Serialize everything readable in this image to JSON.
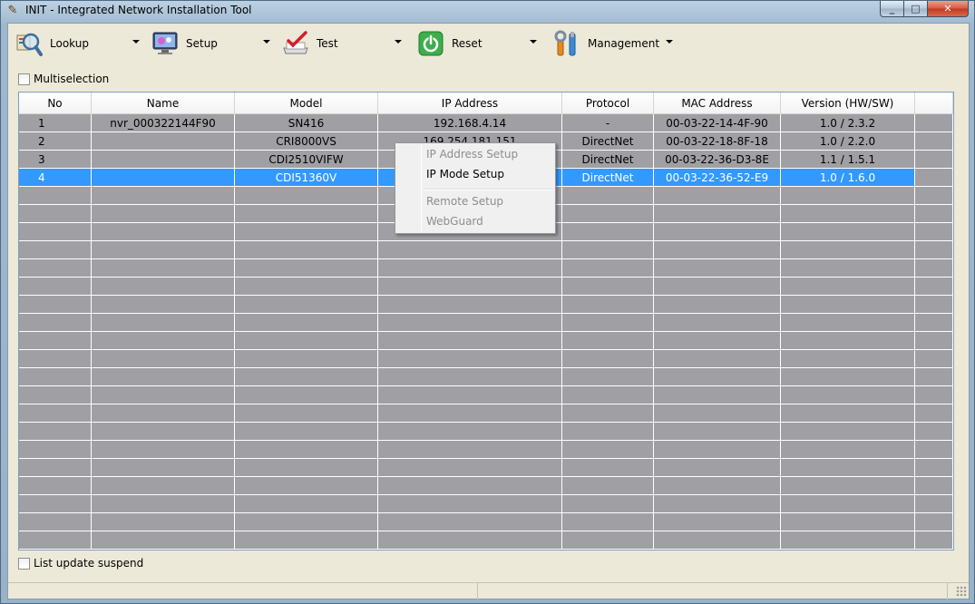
{
  "window": {
    "title": "INIT - Integrated Network Installation Tool",
    "controls": {
      "minimize": "_",
      "maximize": "□",
      "close": "✕"
    }
  },
  "toolbar": {
    "items": [
      {
        "label": "Lookup",
        "icon": "magnifier-icon"
      },
      {
        "label": "Setup",
        "icon": "monitor-settings-icon"
      },
      {
        "label": "Test",
        "icon": "checkmark-icon"
      },
      {
        "label": "Reset",
        "icon": "power-icon"
      },
      {
        "label": "Management",
        "icon": "tools-icon"
      }
    ]
  },
  "multiselection": {
    "label": "Multiselection",
    "checked": false
  },
  "table": {
    "columns": [
      "No",
      "Name",
      "Model",
      "IP Address",
      "Protocol",
      "MAC Address",
      "Version (HW/SW)"
    ],
    "rows": [
      {
        "no": "1",
        "name": "nvr_000322144F90",
        "model": "SN416",
        "ip": "192.168.4.14",
        "protocol": "-",
        "mac": "00-03-22-14-4F-90",
        "version": "1.0 / 2.3.2"
      },
      {
        "no": "2",
        "name": "",
        "model": "CRI8000VS",
        "ip": "169.254.181.151",
        "protocol": "DirectNet",
        "mac": "00-03-22-18-8F-18",
        "version": "1.0 / 2.2.0"
      },
      {
        "no": "3",
        "name": "",
        "model": "CDI2510VIFW",
        "ip": "",
        "protocol": "DirectNet",
        "mac": "00-03-22-36-D3-8E",
        "version": "1.1 / 1.5.1"
      },
      {
        "no": "4",
        "name": "",
        "model": "CDI51360V",
        "ip": "",
        "protocol": "DirectNet",
        "mac": "00-03-22-36-52-E9",
        "version": "1.0 / 1.6.0"
      }
    ],
    "selected_row": 4,
    "colors": {
      "selection": "#3399ff",
      "grid_bg": "#a09fa4"
    }
  },
  "context_menu": {
    "items": [
      {
        "label": "IP Address Setup",
        "enabled": false
      },
      {
        "label": "IP Mode Setup",
        "enabled": true
      },
      {
        "label": "Remote Setup",
        "enabled": false
      },
      {
        "label": "WebGuard",
        "enabled": false
      }
    ]
  },
  "list_update_suspend": {
    "label": "List update suspend",
    "checked": false
  }
}
